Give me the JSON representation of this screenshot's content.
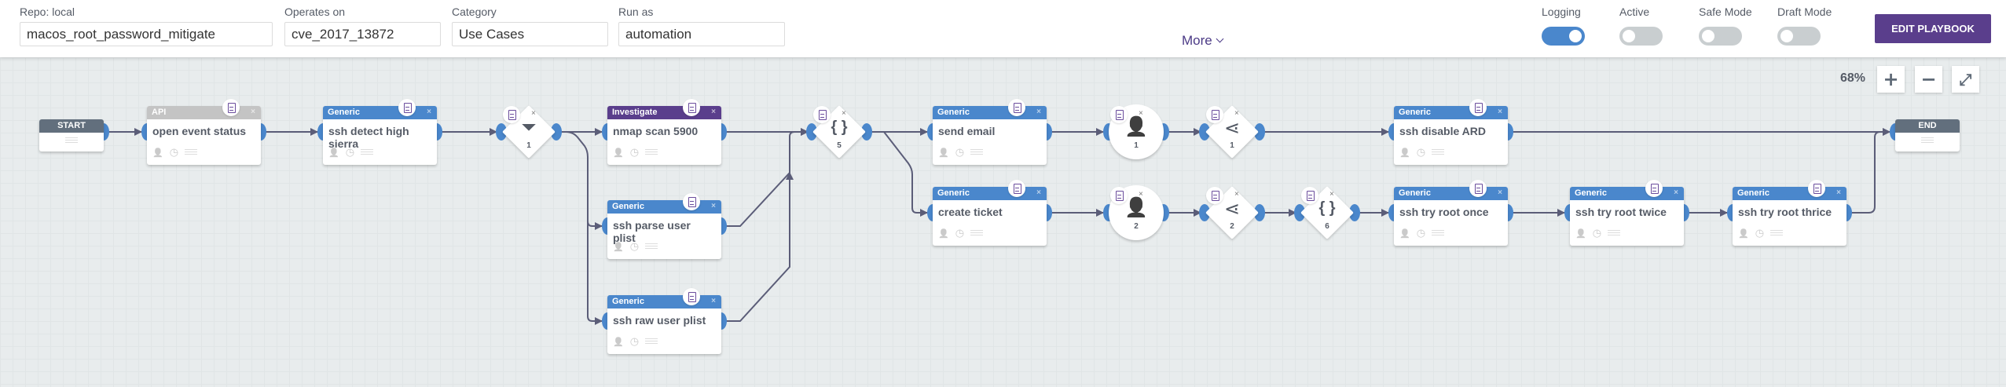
{
  "header": {
    "repo_label": "Repo: local",
    "repo_value": "macos_root_password_mitigate",
    "operates_label": "Operates on",
    "operates_value": "cve_2017_13872",
    "category_label": "Category",
    "category_value": "Use Cases",
    "runas_label": "Run as",
    "runas_value": "automation",
    "more_label": "More",
    "toggles": [
      {
        "label": "Logging",
        "on": true
      },
      {
        "label": "Active",
        "on": false
      },
      {
        "label": "Safe Mode",
        "on": false
      },
      {
        "label": "Draft Mode",
        "on": false
      }
    ],
    "edit_button": "EDIT PLAYBOOK"
  },
  "zoom": {
    "level": "68%",
    "plus": "+",
    "minus": "−",
    "fit": "⤢"
  },
  "colors": {
    "generic": "#4a87cc",
    "investigate": "#5a3e8c",
    "api": "#c4c4c4",
    "startend": "#626f7d",
    "edit": "#5a3e8c"
  },
  "start": "START",
  "end": "END",
  "close": "×",
  "nodes": [
    {
      "type": "API",
      "title": "open event status"
    },
    {
      "type": "Generic",
      "title": "ssh detect high sierra"
    },
    {
      "type": "Investigate",
      "title": "nmap scan 5900"
    },
    {
      "type": "Generic",
      "title": "ssh parse user plist"
    },
    {
      "type": "Generic",
      "title": "ssh raw user plist"
    },
    {
      "type": "Generic",
      "title": "send email"
    },
    {
      "type": "Generic",
      "title": "create ticket"
    },
    {
      "type": "Generic",
      "title": "ssh disable ARD"
    },
    {
      "type": "Generic",
      "title": "ssh try root once"
    },
    {
      "type": "Generic",
      "title": "ssh try root twice"
    },
    {
      "type": "Generic",
      "title": "ssh try root thrice"
    }
  ],
  "blocks": [
    {
      "kind": "filter",
      "number": "1",
      "glyph": "⏷"
    },
    {
      "kind": "format",
      "number": "5",
      "glyph": "{ }"
    },
    {
      "kind": "prompt",
      "number": "1",
      "glyph": "👤"
    },
    {
      "kind": "decision",
      "number": "1",
      "glyph": "⋖"
    },
    {
      "kind": "prompt",
      "number": "2",
      "glyph": "👤"
    },
    {
      "kind": "decision",
      "number": "2",
      "glyph": "⋖"
    },
    {
      "kind": "format",
      "number": "6",
      "glyph": "{ }"
    }
  ],
  "footer_icons": {
    "user": "👤",
    "clock": "◷"
  }
}
